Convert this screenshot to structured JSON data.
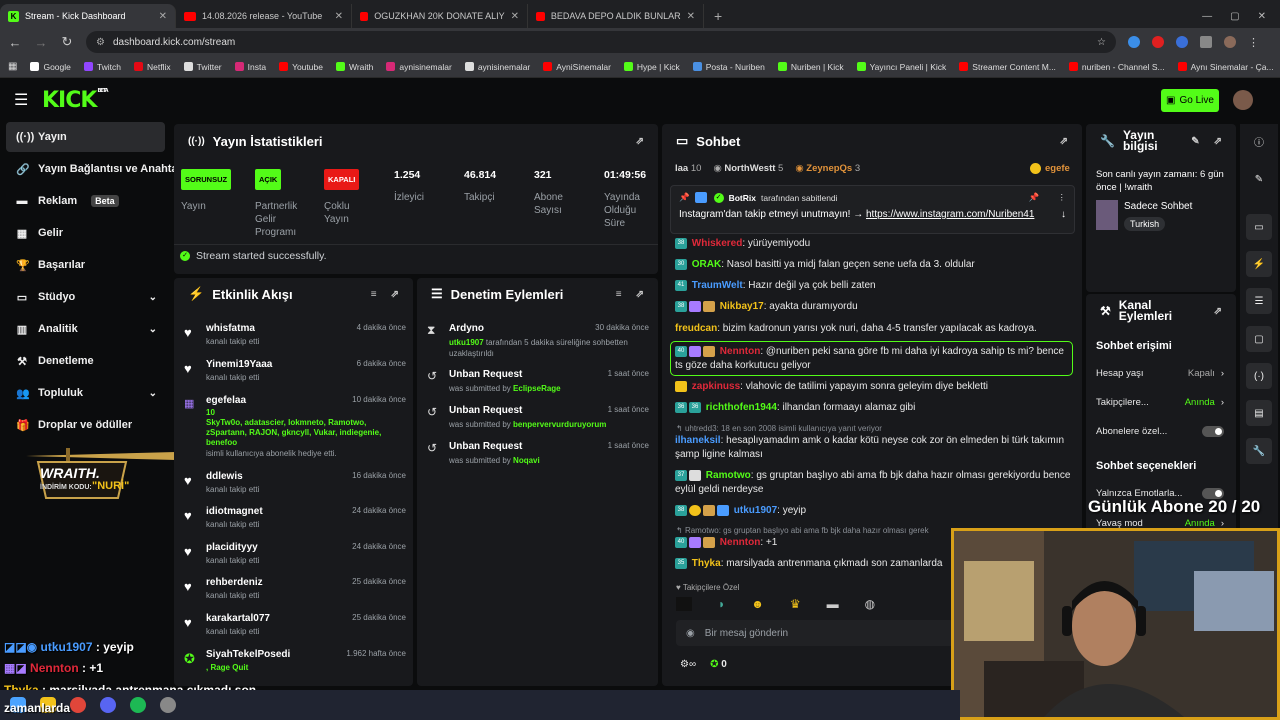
{
  "browser": {
    "tabs": [
      {
        "label": "Stream - Kick Dashboard",
        "icon": "kick"
      },
      {
        "label": "14.08.2026 release - YouTube",
        "icon": "youtube"
      },
      {
        "label": "OGUZKHAN 20K DONATE ALIY",
        "icon": "youtube"
      },
      {
        "label": "BEDAVA DEPO ALDIK BUNLAR",
        "icon": "youtube"
      }
    ],
    "url": "dashboard.kick.com/stream",
    "bookmarks": [
      "Google",
      "Twitch",
      "Netflix",
      "Twitter",
      "Insta",
      "Youtube",
      "Wraith",
      "aynisinemalar",
      "aynisinemalar",
      "AyniSinemalar",
      "Hype | Kick",
      "Posta - Nuriben",
      "Nuriben | Kick",
      "Yayıncı Paneli | Kick",
      "Streamer Content M...",
      "nuriben - Channel S...",
      "Aynı Sinemalar - Ça..."
    ]
  },
  "header": {
    "logo": "KICK",
    "logo_beta": "BETA",
    "go_live": "Go Live"
  },
  "sidebar": {
    "items": [
      {
        "label": "Yayın"
      },
      {
        "label": "Yayın Bağlantısı ve Anahtar"
      },
      {
        "label": "Reklam",
        "badge": "Beta"
      },
      {
        "label": "Gelir"
      },
      {
        "label": "Başarılar"
      },
      {
        "label": "Stüdyo"
      },
      {
        "label": "Analitik"
      },
      {
        "label": "Denetleme"
      },
      {
        "label": "Topluluk"
      },
      {
        "label": "Droplar ve ödüller"
      }
    ],
    "promo": {
      "brand": "WRAITH.",
      "code_label": "İNDİRİM KODU:",
      "code": "\"NURİ\""
    }
  },
  "stats": {
    "title": "Yayın İstatistikleri",
    "cols": [
      {
        "pill": "SORUNSUZ",
        "label": "Yayın"
      },
      {
        "pill": "AÇIK",
        "label": "Partnerlik Gelir Programı"
      },
      {
        "pill": "KAPALI",
        "label": "Çoklu Yayın"
      },
      {
        "value": "1.254",
        "label": "İzleyici"
      },
      {
        "value": "46.814",
        "label": "Takipçi"
      },
      {
        "value": "321",
        "label": "Abone Sayısı"
      },
      {
        "value": "01:49:56",
        "label": "Yayında Olduğu Süre"
      }
    ],
    "status": "Stream started successfully.",
    "colors": {
      "ok": "#53fc18",
      "off": "#e91916"
    }
  },
  "activity": {
    "title": "Etkinlik Akışı",
    "items": [
      {
        "name": "whisfatma",
        "sub": "kanalı takip etti",
        "time": "4 dakika önce"
      },
      {
        "name": "Yinemi19Yaaa",
        "sub": "kanalı takip etti",
        "time": "6 dakika önce"
      },
      {
        "name": "egefelaa",
        "count": "10",
        "gifted": "SkyTw0o, adatascier, lokmneto, Ramotwo, zSpartann, RAJON, gkncyll, Vukar, indiegenie, benefoo",
        "sub": "isimli kullanıcıya abonelik hediye etti.",
        "time": "10 dakika önce"
      },
      {
        "name": "ddlewis",
        "sub": "kanalı takip etti",
        "time": "16 dakika önce"
      },
      {
        "name": "idiotmagnet",
        "sub": "kanalı takip etti",
        "time": "24 dakika önce"
      },
      {
        "name": "placidityyy",
        "sub": "kanalı takip etti",
        "time": "24 dakika önce"
      },
      {
        "name": "rehberdeniz",
        "sub": "kanalı takip etti",
        "time": "25 dakika önce"
      },
      {
        "name": "karakartal077",
        "sub": "kanalı takip etti",
        "time": "25 dakika önce"
      },
      {
        "name": "SiyahTekelPosedi",
        "sub": ", Rage Quit",
        "time": "1.962 hafta önce"
      }
    ]
  },
  "moderation": {
    "title": "Denetim Eylemleri",
    "items": [
      {
        "name": "Ardyno",
        "time": "30 dakika önce",
        "actor": "utku1907",
        "sub": "tarafından 5 dakika süreliğine sohbetten uzaklaştırıldı"
      },
      {
        "name": "Unban Request",
        "time": "1 saat önce",
        "prefix": "was submitted by",
        "actor": "EclipseRage"
      },
      {
        "name": "Unban Request",
        "time": "1 saat önce",
        "prefix": "was submitted by",
        "actor": "benpervervurduruyorum"
      },
      {
        "name": "Unban Request",
        "time": "1 saat önce",
        "prefix": "was submitted by",
        "actor": "Noqavi"
      }
    ]
  },
  "chat": {
    "title": "Sohbet",
    "top_users": [
      {
        "name": "laa",
        "count": "10"
      },
      {
        "name": "NorthWestt",
        "count": "5"
      },
      {
        "name": "ZeynepQs",
        "count": "3"
      },
      {
        "name": "egefe",
        "count": ""
      }
    ],
    "pinned": {
      "by": "BotRix",
      "by_suffix": "tarafından sabitlendi",
      "text": "Instagram'dan takip etmeyi unutmayın! → ",
      "link": "https://www.instagram.com/Nuriben41"
    },
    "messages": [
      {
        "user": "Whiskered",
        "color": "#e0293a",
        "text": ": yürüyemiyodu"
      },
      {
        "user": "ORAK",
        "color": "#53fc18",
        "text": ": Nasol basitti ya midj falan geçen sene uefa da 3. oldular"
      },
      {
        "user": "TraumWelt",
        "color": "#4a9cff",
        "text": ": Hazır değil ya çok belli zaten"
      },
      {
        "user": "Nikbay17",
        "color": "#f2c21a",
        "text": ": ayakta duramıyordu"
      },
      {
        "user": "freudcan",
        "color": "#f2c21a",
        "text": ": bizim kadronun yarısı yok nuri, daha 4-5 transfer yapılacak as kadroya."
      },
      {
        "user": "Nennton",
        "color": "#e0293a",
        "text": ": @nuriben peki sana göre fb mi daha iyi kadroya sahip ts mi? bence ts göze daha korkutucu geliyor"
      },
      {
        "user": "zapkinuss",
        "color": "#e0293a",
        "text": ": vlahovic de tatilimi yapayım sonra geleyim diye bekletti"
      },
      {
        "user": "richthofen1944",
        "color": "#53fc18",
        "text": ": ilhandan formaayı alamaz gibi"
      },
      {
        "reply": "uhtredd3: 18 en son 2008 isimli kullanıcıya yanıt veriyor"
      },
      {
        "user": "ilhaneksil",
        "color": "#4a9cff",
        "text": ": hesaplıyamadım amk o kadar kötü neyse cok zor ön elmeden bi türk takımın şamp ligine kalması"
      },
      {
        "user": "Ramotwo",
        "color": "#53fc18",
        "text": ": gs gruptan başlıyo abi ama fb bjk daha hazır olması gerekiyordu bence eylül geldi nerdeyse"
      },
      {
        "user": "utku1907",
        "color": "#4a9cff",
        "text": ": yeyip"
      },
      {
        "reply": "Ramotwo: gs gruptan başlıyo abi ama fb bjk daha hazır olması gerek"
      },
      {
        "user": "Nennton",
        "color": "#e0293a",
        "text": ": +1"
      },
      {
        "user": "Thyka",
        "color": "#f2c21a",
        "text": ": marsilyada antrenmana çıkmadı son zamanlarda"
      }
    ],
    "emotes_label": "Takipçilere Özel",
    "input_placeholder": "Bir mesaj gönderin",
    "points": "0"
  },
  "stream_info": {
    "title": "Yayın bilgisi",
    "last_live": "Son canlı yayın zamanı: 6 gün önce | !wraith",
    "category": "Sadece Sohbet",
    "language": "Turkish"
  },
  "channel_actions": {
    "title": "Kanal Eylemleri",
    "chat_access": "Sohbet erişimi",
    "rows": [
      {
        "label": "Hesap yaşı",
        "value": "Kapalı"
      },
      {
        "label": "Takipçilere...",
        "value": "Anında"
      },
      {
        "label": "Abonelere özel...",
        "value": ""
      }
    ],
    "chat_options": "Sohbet seçenekleri",
    "rows2": [
      {
        "label": "Yalnızca Emotlarla...",
        "value": ""
      },
      {
        "label": "Yavaş mod",
        "value": "Anında"
      }
    ]
  },
  "overlay": {
    "sub_goal": "Günlük Abone 20 / 20",
    "chat_lines": [
      {
        "user": "utku1907",
        "text": " : yeyip",
        "color": "#4a9cff"
      },
      {
        "user": "Nennton",
        "text": " : +1",
        "color": "#e0293a"
      },
      {
        "user": "Thyka",
        "text": " : marsilyada antrenmana çıkmadı son",
        "color": "#f2c21a"
      }
    ],
    "chat_wrap": "zamanlarda"
  }
}
